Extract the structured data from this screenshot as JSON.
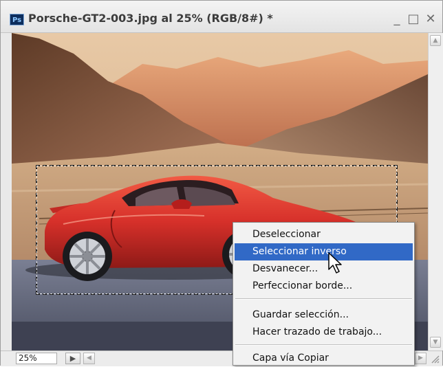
{
  "window": {
    "app_icon_text": "Ps",
    "title": "Porsche-GT2-003.jpg al 25% (RGB/8#) *",
    "minimize_glyph": "_",
    "maximize_glyph": "□",
    "close_glyph": "✕"
  },
  "status": {
    "zoom": "25%"
  },
  "context_menu": {
    "items": [
      {
        "label": "Deseleccionar"
      },
      {
        "label": "Seleccionar inverso",
        "highlighted": true
      },
      {
        "label": "Desvanecer..."
      },
      {
        "label": "Perfeccionar borde..."
      },
      {
        "label": "Guardar selección..."
      },
      {
        "label": "Hacer trazado de trabajo..."
      },
      {
        "label": "Capa vía Copiar"
      }
    ]
  },
  "colors": {
    "menu_highlight": "#3169c6",
    "car_body": "#d6302a",
    "sky": "#d7b48a",
    "photoshop_icon_bg": "#0d2d5c"
  },
  "icons": {
    "app": "photoshop-icon",
    "status_button": "page-arrow-icon",
    "cursor": "arrow-cursor-icon"
  }
}
